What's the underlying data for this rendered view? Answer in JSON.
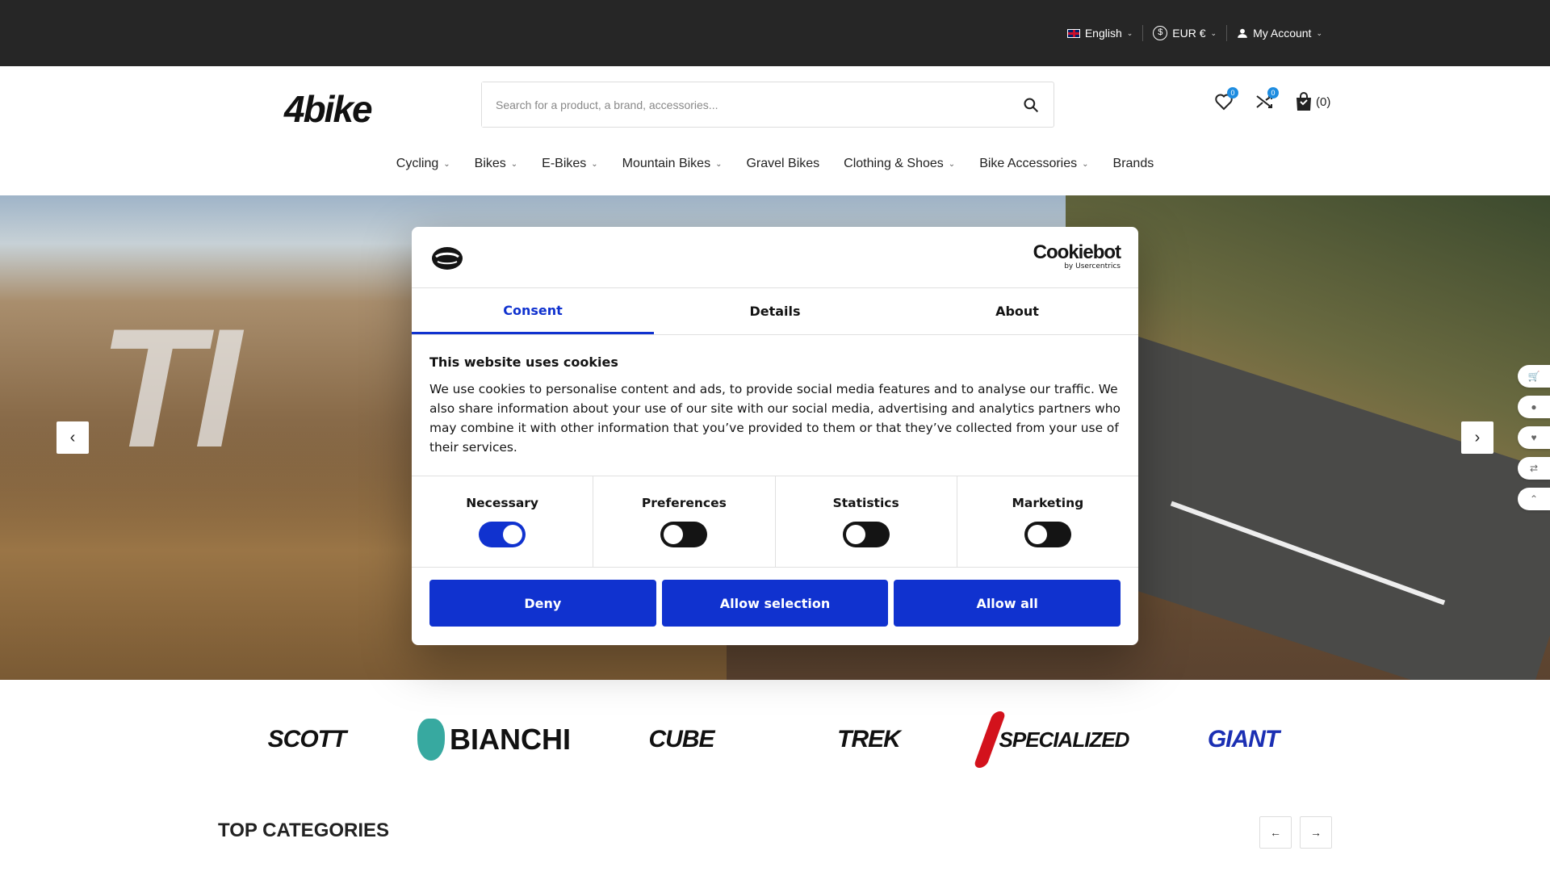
{
  "topbar": {
    "language": "English",
    "currency": "EUR €",
    "currency_symbol": "$",
    "account": "My Account"
  },
  "header": {
    "logo": "4bike",
    "search_placeholder": "Search for a product, a brand, accessories...",
    "wishlist_count": "0",
    "compare_count": "0",
    "cart_count": "(0)"
  },
  "nav": {
    "items": [
      {
        "label": "Cycling",
        "has_dropdown": true
      },
      {
        "label": "Bikes",
        "has_dropdown": true
      },
      {
        "label": "E-Bikes",
        "has_dropdown": true
      },
      {
        "label": "Mountain Bikes",
        "has_dropdown": true
      },
      {
        "label": "Gravel Bikes",
        "has_dropdown": false
      },
      {
        "label": "Clothing & Shoes",
        "has_dropdown": true
      },
      {
        "label": "Bike Accessories",
        "has_dropdown": true
      },
      {
        "label": "Brands",
        "has_dropdown": false
      }
    ]
  },
  "hero": {
    "overlay_text": "TI"
  },
  "cookie": {
    "brand": "Cookiebot",
    "brand_by": "by Usercentrics",
    "tabs": [
      "Consent",
      "Details",
      "About"
    ],
    "title": "This website uses cookies",
    "text": "We use cookies to personalise content and ads, to provide social media features and to analyse our traffic. We also share information about your use of our site with our social media, advertising and analytics partners who may combine it with other information that you’ve provided to them or that they’ve collected from your use of their services.",
    "categories": [
      {
        "label": "Necessary",
        "on": true
      },
      {
        "label": "Preferences",
        "on": false
      },
      {
        "label": "Statistics",
        "on": false
      },
      {
        "label": "Marketing",
        "on": false
      }
    ],
    "buttons": {
      "deny": "Deny",
      "selection": "Allow selection",
      "all": "Allow all"
    },
    "accent": "#1032cf"
  },
  "brands": [
    "SCOTT",
    "BIANCHI",
    "CUBE",
    "TREK",
    "SPECIALIZED",
    "GIANT"
  ],
  "section": {
    "title": "TOP CATEGORIES"
  }
}
